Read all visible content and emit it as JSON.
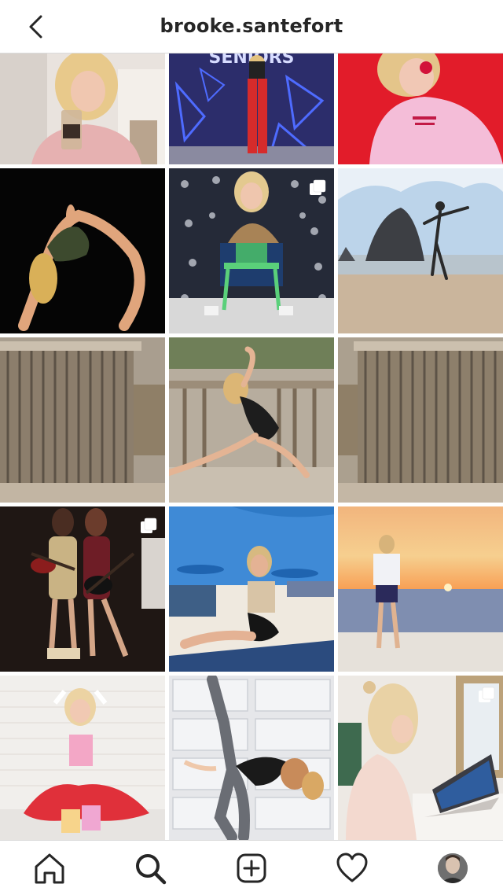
{
  "header": {
    "username": "brooke.santefort",
    "back_icon": "chevron-left-icon"
  },
  "posts": [
    {
      "id": 1,
      "description": "girl drinking iced coffee",
      "multiple": false
    },
    {
      "id": 2,
      "description": "girl in red leggings in front of seniors banner",
      "multiple": false,
      "banner_text": "SENIORS"
    },
    {
      "id": 3,
      "description": "girl in pink sweatshirt red background",
      "multiple": false
    },
    {
      "id": 4,
      "description": "dancer backbend on black background",
      "multiple": false
    },
    {
      "id": 5,
      "description": "girl on green chair holding drink",
      "multiple": true
    },
    {
      "id": 6,
      "description": "dancer leaping on beach with sea stack",
      "multiple": false
    },
    {
      "id": 7,
      "description": "wooden boardwalk fence left",
      "multiple": false
    },
    {
      "id": 8,
      "description": "dancer stretching on boardwalk",
      "multiple": false
    },
    {
      "id": 9,
      "description": "wooden boardwalk fence right",
      "multiple": false
    },
    {
      "id": 10,
      "description": "two girls with guitars",
      "multiple": true
    },
    {
      "id": 11,
      "description": "girl posing on beach towel",
      "multiple": false
    },
    {
      "id": 12,
      "description": "girl on beach at sunset",
      "multiple": false
    },
    {
      "id": 13,
      "description": "girl in pink top sitting with products",
      "multiple": false
    },
    {
      "id": 14,
      "description": "two dancers pose in front of drawers",
      "multiple": false
    },
    {
      "id": 15,
      "description": "girl working on laptop",
      "multiple": true
    }
  ],
  "bottom_nav": [
    {
      "name": "home",
      "icon": "home-icon"
    },
    {
      "name": "search",
      "icon": "search-icon"
    },
    {
      "name": "new-post",
      "icon": "plus-square-icon"
    },
    {
      "name": "activity",
      "icon": "heart-icon"
    },
    {
      "name": "profile",
      "icon": "profile-avatar"
    }
  ],
  "colors": {
    "border": "#dbdbdb",
    "text": "#262626"
  }
}
